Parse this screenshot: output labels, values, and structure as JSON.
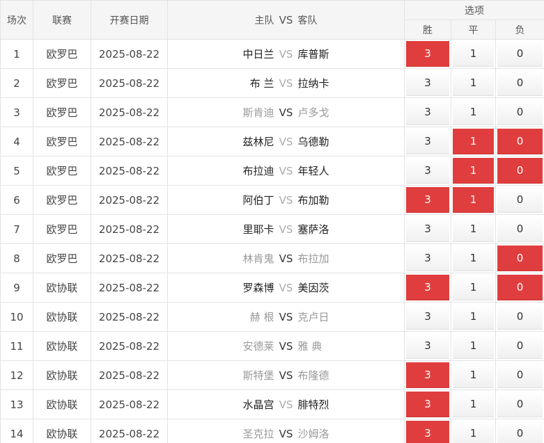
{
  "header": {
    "num": "场次",
    "league": "联赛",
    "date": "开赛日期",
    "home": "主队",
    "vs": "VS",
    "away": "客队",
    "options": "选项",
    "win": "胜",
    "draw": "平",
    "loss": "负"
  },
  "colors": {
    "selected": "#e03e3e",
    "header_bg": "#f5f5f5"
  },
  "rows": [
    {
      "num": "1",
      "league": "欧罗巴",
      "date": "2025-08-22",
      "home": "中日兰",
      "vs": "VS",
      "away": "库普斯",
      "win": "3",
      "draw": "1",
      "loss": "0",
      "sel": [
        true,
        false,
        false
      ],
      "dim": false
    },
    {
      "num": "2",
      "league": "欧罗巴",
      "date": "2025-08-22",
      "home": "布 兰",
      "vs": "VS",
      "away": "拉纳卡",
      "win": "3",
      "draw": "1",
      "loss": "0",
      "sel": [
        false,
        false,
        false
      ],
      "dim": false
    },
    {
      "num": "3",
      "league": "欧罗巴",
      "date": "2025-08-22",
      "home": "斯肯迪",
      "vs": "VS",
      "away": "卢多戈",
      "win": "3",
      "draw": "1",
      "loss": "0",
      "sel": [
        false,
        false,
        false
      ],
      "dim": true
    },
    {
      "num": "4",
      "league": "欧罗巴",
      "date": "2025-08-22",
      "home": "兹林尼",
      "vs": "VS",
      "away": "乌德勒",
      "win": "3",
      "draw": "1",
      "loss": "0",
      "sel": [
        false,
        true,
        true
      ],
      "dim": false
    },
    {
      "num": "5",
      "league": "欧罗巴",
      "date": "2025-08-22",
      "home": "布拉迪",
      "vs": "VS",
      "away": "年轻人",
      "win": "3",
      "draw": "1",
      "loss": "0",
      "sel": [
        false,
        true,
        true
      ],
      "dim": false
    },
    {
      "num": "6",
      "league": "欧罗巴",
      "date": "2025-08-22",
      "home": "阿伯丁",
      "vs": "VS",
      "away": "布加勒",
      "win": "3",
      "draw": "1",
      "loss": "0",
      "sel": [
        true,
        true,
        false
      ],
      "dim": false
    },
    {
      "num": "7",
      "league": "欧罗巴",
      "date": "2025-08-22",
      "home": "里耶卡",
      "vs": "VS",
      "away": "塞萨洛",
      "win": "3",
      "draw": "1",
      "loss": "0",
      "sel": [
        false,
        false,
        false
      ],
      "dim": false
    },
    {
      "num": "8",
      "league": "欧罗巴",
      "date": "2025-08-22",
      "home": "林肯鬼",
      "vs": "VS",
      "away": "布拉加",
      "win": "3",
      "draw": "1",
      "loss": "0",
      "sel": [
        false,
        false,
        true
      ],
      "dim": true
    },
    {
      "num": "9",
      "league": "欧协联",
      "date": "2025-08-22",
      "home": "罗森博",
      "vs": "VS",
      "away": "美因茨",
      "win": "3",
      "draw": "1",
      "loss": "0",
      "sel": [
        true,
        false,
        true
      ],
      "dim": false
    },
    {
      "num": "10",
      "league": "欧协联",
      "date": "2025-08-22",
      "home": "赫 根",
      "vs": "VS",
      "away": "克卢日",
      "win": "3",
      "draw": "1",
      "loss": "0",
      "sel": [
        false,
        false,
        false
      ],
      "dim": true
    },
    {
      "num": "11",
      "league": "欧协联",
      "date": "2025-08-22",
      "home": "安德莱",
      "vs": "VS",
      "away": "雅 典",
      "win": "3",
      "draw": "1",
      "loss": "0",
      "sel": [
        false,
        false,
        false
      ],
      "dim": true
    },
    {
      "num": "12",
      "league": "欧协联",
      "date": "2025-08-22",
      "home": "斯特堡",
      "vs": "VS",
      "away": "布隆德",
      "win": "3",
      "draw": "1",
      "loss": "0",
      "sel": [
        true,
        false,
        false
      ],
      "dim": true
    },
    {
      "num": "13",
      "league": "欧协联",
      "date": "2025-08-22",
      "home": "水晶宫",
      "vs": "VS",
      "away": "腓特烈",
      "win": "3",
      "draw": "1",
      "loss": "0",
      "sel": [
        true,
        false,
        false
      ],
      "dim": false
    },
    {
      "num": "14",
      "league": "欧协联",
      "date": "2025-08-22",
      "home": "圣克拉",
      "vs": "VS",
      "away": "沙姆洛",
      "win": "3",
      "draw": "1",
      "loss": "0",
      "sel": [
        true,
        false,
        false
      ],
      "dim": true
    }
  ]
}
